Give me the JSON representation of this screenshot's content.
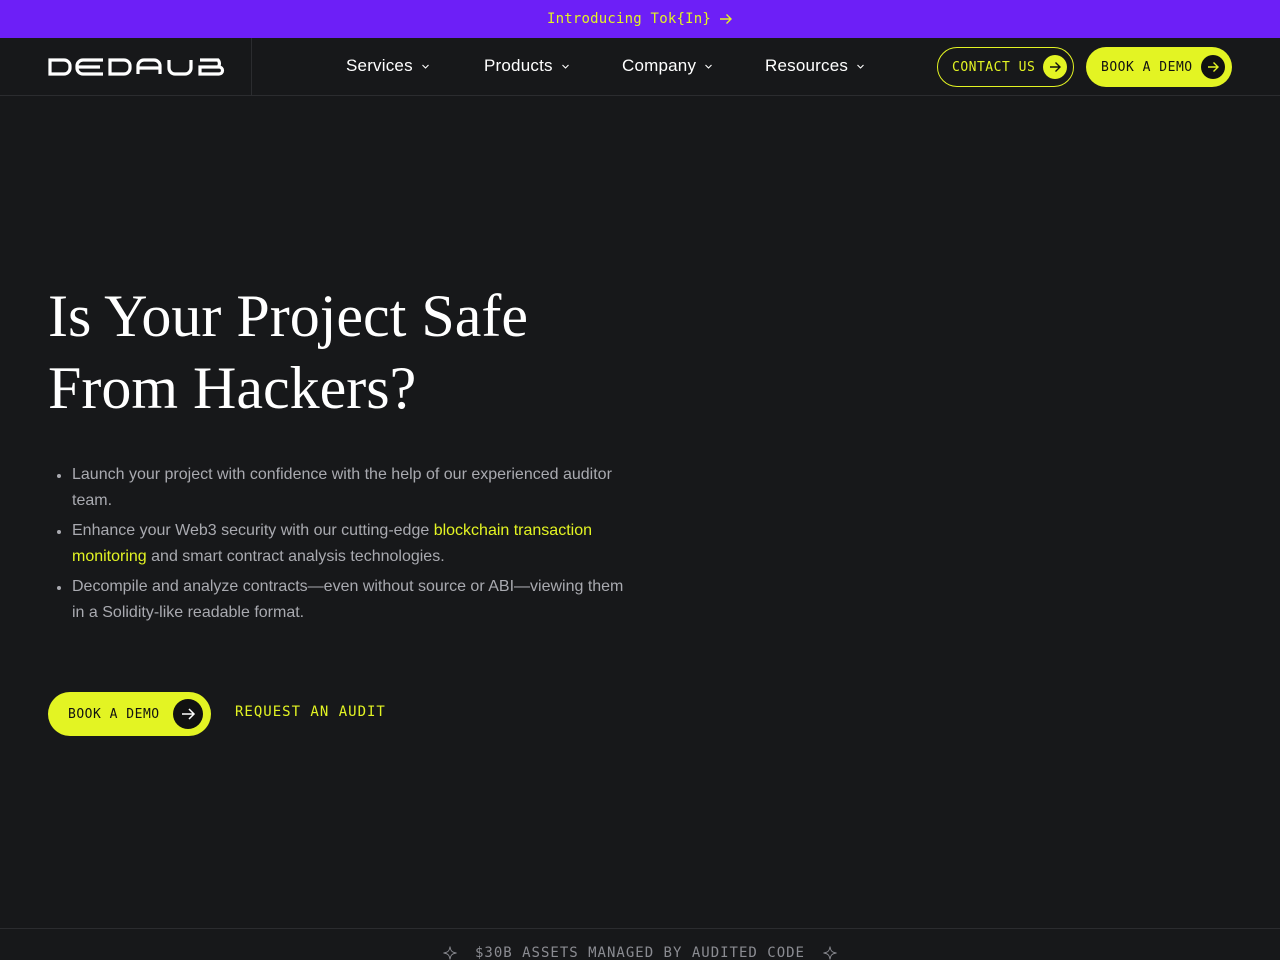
{
  "banner": {
    "text": "Introducing Tok{In}",
    "icon": "arrow-right-icon"
  },
  "header": {
    "logo_text": "DEDAUB",
    "nav": [
      {
        "label": "Services",
        "icon": "chevron-down-icon"
      },
      {
        "label": "Products",
        "icon": "chevron-down-icon"
      },
      {
        "label": "Company",
        "icon": "chevron-down-icon"
      },
      {
        "label": "Resources",
        "icon": "chevron-down-icon"
      }
    ],
    "contact_label": "CONTACT US",
    "demo_label": "BOOK A DEMO"
  },
  "hero": {
    "title_line1": "Is Your Project Safe",
    "title_line2": "From Hackers?",
    "bullets": [
      {
        "text": "Launch your project with confidence with the help of our experienced auditor team."
      },
      {
        "before": "Enhance your Web3 security with our cutting-edge ",
        "link": "blockchain transaction monitoring",
        "after": " and smart contract analysis technologies."
      },
      {
        "text": "Decompile and analyze contracts—even without source or ABI—viewing them in a Solidity-like readable format."
      }
    ],
    "cta_primary": "BOOK A DEMO",
    "cta_secondary": "REQUEST AN AUDIT"
  },
  "stats": {
    "text": "$30B ASSETS MANAGED BY AUDITED CODE",
    "icon": "sparkle-icon"
  },
  "colors": {
    "accent": "#e3f423",
    "banner": "#6d1ff7",
    "background": "#17181a"
  }
}
